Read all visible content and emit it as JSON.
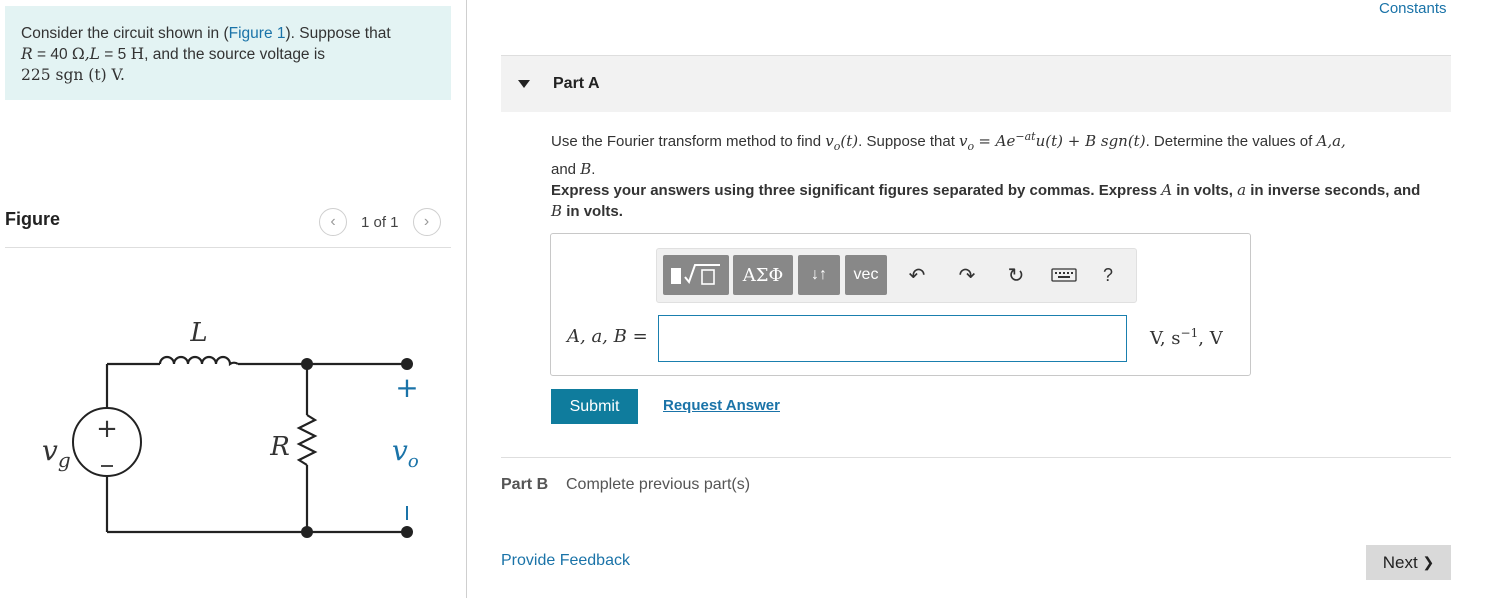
{
  "problem": {
    "line1_prefix": "Consider the circuit shown in (",
    "figure_link": "Figure 1",
    "line1_suffix": "). Suppose that",
    "line2_r": "R",
    "line2_rval": " = 40 ",
    "line2_ohm": "Ω",
    "line2_l": ",L",
    "line2_lval": " = 5 ",
    "line2_h": "H",
    "line2_suffix": ", and the source voltage is",
    "line3": "225 sgn (t)  V."
  },
  "figure": {
    "heading": "Figure",
    "counter": "1 of 1",
    "prev_icon": "chevron-left",
    "next_icon": "chevron-right",
    "labels": {
      "inductor": "L",
      "resistor": "R",
      "source": "v",
      "source_sub": "g",
      "output": "v",
      "output_sub": "o",
      "plus": "+",
      "minus": "−"
    }
  },
  "header": {
    "constants_link": "Constants"
  },
  "part_a": {
    "title": "Part A",
    "instruction_pre": "Use the Fourier transform method to find ",
    "instruction_vo": "v",
    "instruction_vo_sub": "o",
    "instruction_t": "(t)",
    "instruction_mid": ". Suppose that ",
    "instruction_eq": "= Ae",
    "instruction_exp": "−at",
    "instruction_eq2": "u(t) + B sgn(t)",
    "instruction_post": ". Determine the values of ",
    "instruction_vars": "A,a,",
    "instruction_and": "and ",
    "instruction_b": "B",
    "instruction_end": ".",
    "express_1": "Express your answers using three significant figures separated by commas. Express ",
    "express_a": "A",
    "express_2": " in volts, ",
    "express_alpha": "a",
    "express_3": " in inverse seconds, and ",
    "express_b": "B",
    "express_4": " in volts.",
    "toolbar": {
      "templates_icon": "sqrt-template-icon",
      "greek": "ΑΣΦ",
      "arrows": "↓↑",
      "vec": "vec",
      "undo_icon": "undo",
      "redo_icon": "redo",
      "reset_icon": "reset",
      "keyboard_icon": "keyboard",
      "help": "?"
    },
    "answer_label": "A, a, B =",
    "answer_value": "",
    "answer_units": "V, s",
    "answer_units_exp": "−1",
    "answer_units_end": ", V",
    "submit_label": "Submit",
    "request_answer_label": "Request Answer"
  },
  "part_b": {
    "title": "Part B",
    "status": "Complete previous part(s)"
  },
  "footer": {
    "feedback_link": "Provide Feedback",
    "next_label": "Next",
    "next_icon": "❯"
  },
  "colors": {
    "accent": "#0f7c9d",
    "link": "#1a73a8",
    "problem_bg": "#e3f3f3"
  }
}
